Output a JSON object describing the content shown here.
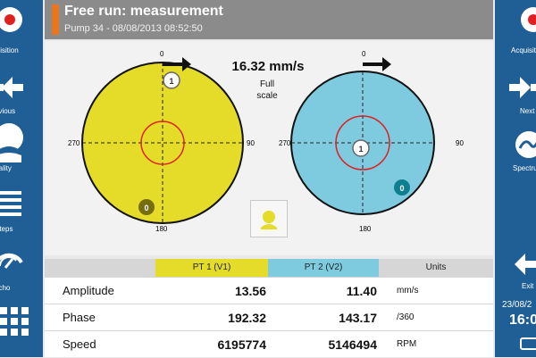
{
  "header": {
    "title": "Free run: measurement",
    "subtitle": "Pump 34 - 08/08/2013 08:52:50"
  },
  "left_sidebar": {
    "items": [
      {
        "icon": "record-icon",
        "label": "Acquisition"
      },
      {
        "icon": "arrow-left-icon",
        "label": "Previous"
      },
      {
        "icon": "operator-face-icon",
        "label": "Quality"
      },
      {
        "icon": "list-lines-icon",
        "label": "Steps"
      },
      {
        "icon": "gauge-icon",
        "label": "Tacho"
      },
      {
        "icon": "grid-icon",
        "label": ""
      }
    ]
  },
  "right_sidebar": {
    "items": [
      {
        "icon": "record-icon",
        "label": "Acquisition"
      },
      {
        "icon": "arrow-right-icon",
        "label": "Next"
      },
      {
        "icon": "spectrum-icon",
        "label": "Spectrum"
      },
      {
        "icon": "exit-icon",
        "label": "Exit"
      }
    ],
    "date": "23/08/2",
    "time": "16:0"
  },
  "polar": {
    "amplitude": "16.32 mm/s",
    "scale_label": "Full scale",
    "left_plot": {
      "fill": "#e5dc29",
      "label_top": "0",
      "label_right": "90",
      "label_bottom": "180",
      "label_left": "270",
      "marker1": "1",
      "marker0": "0"
    },
    "right_plot": {
      "fill": "#7ecbe0",
      "label_top": "0",
      "label_right": "90",
      "label_bottom": "180",
      "label_left": "270",
      "marker1": "1",
      "marker0": "0"
    },
    "center_icon": "operator-icon"
  },
  "table": {
    "headers": [
      "PT 1 (V1)",
      "PT 2 (V2)",
      "Units"
    ],
    "rows": [
      {
        "label": "Amplitude",
        "v1": "13.56",
        "v2": "11.40",
        "unit": "mm/s"
      },
      {
        "label": "Phase",
        "v1": "192.32",
        "v2": "143.17",
        "unit": "/360"
      },
      {
        "label": "Speed",
        "v1": "6195774",
        "v2": "5146494",
        "unit": "RPM"
      }
    ]
  },
  "colors": {
    "sidebar": "#1f5f95",
    "accent": "#e9751f",
    "pt1": "#e5dc29",
    "pt2": "#7ecbe0",
    "red": "#e02020"
  }
}
